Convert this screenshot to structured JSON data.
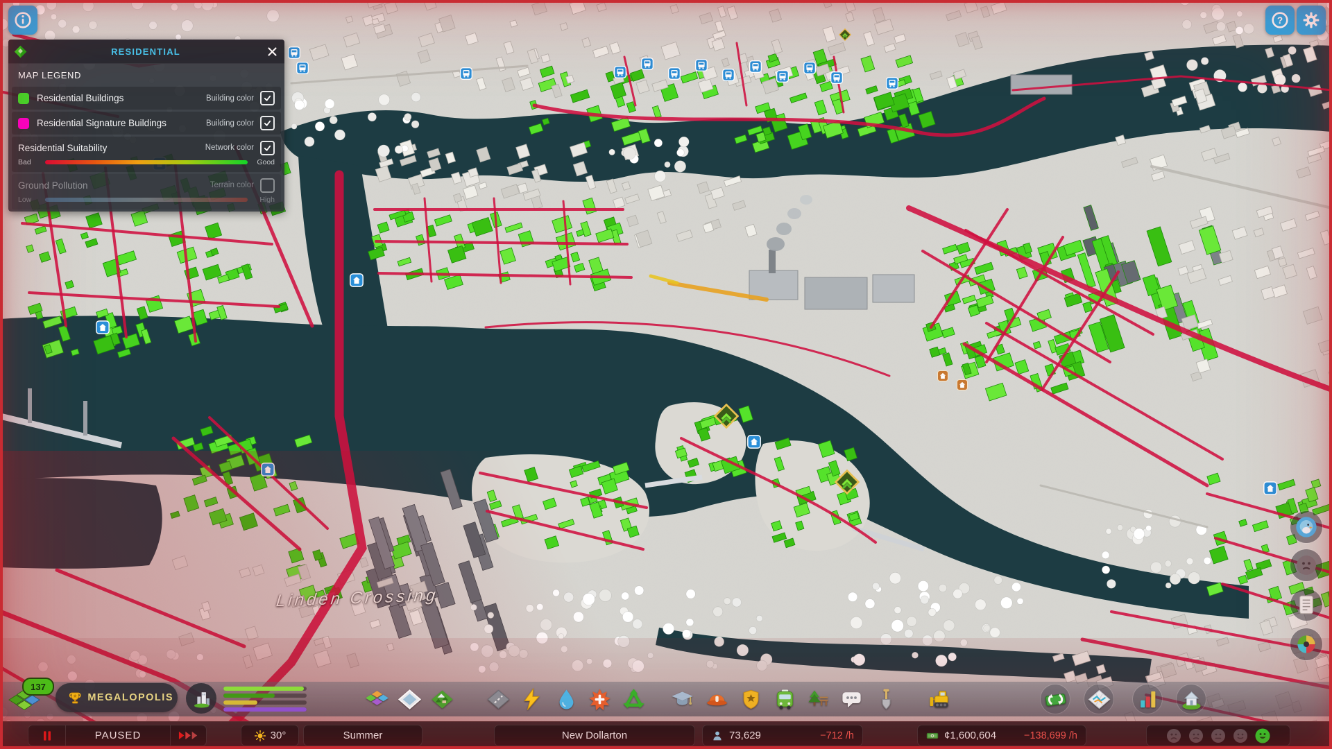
{
  "topbar": {
    "info_icon": "info-views-toggle",
    "help_icon": "help",
    "settings_icon": "gear"
  },
  "legend_panel": {
    "title": "RESIDENTIAL",
    "zone_icon": "residential-zone",
    "close_icon": "close",
    "section_title": "MAP LEGEND",
    "rows": [
      {
        "label": "Residential Buildings",
        "type_label": "Building color",
        "swatch_color": "#3ee02a",
        "checked": true
      },
      {
        "label": "Residential Signature Buildings",
        "type_label": "Building color",
        "swatch_color": "#ff00cc",
        "checked": true
      }
    ],
    "gradient_rows": [
      {
        "label": "Residential Suitability",
        "type_label": "Network color",
        "checked": true,
        "min_label": "Bad",
        "max_label": "Good",
        "enabled": true
      },
      {
        "label": "Ground Pollution",
        "type_label": "Terrain color",
        "checked": false,
        "min_label": "Low",
        "max_label": "High",
        "enabled": false
      }
    ]
  },
  "map": {
    "district_label": "Linden Crossing",
    "marker_types": [
      "transit-stop",
      "residential-service",
      "signature-unlock",
      "housing-demand"
    ]
  },
  "milestone": {
    "level": "137",
    "name": "MEGALOPOLIS"
  },
  "progress": {
    "icon": "city-development",
    "bars": [
      {
        "color": "#8ce23c",
        "value": 97
      },
      {
        "color": "#3f9e16",
        "value": 62
      },
      {
        "color": "#d8c238",
        "value": 41
      },
      {
        "color": "#8e54d8",
        "value": 100
      }
    ]
  },
  "toolbar": {
    "icons": [
      "zoning",
      "areas",
      "terraforming",
      "roads",
      "electricity",
      "water",
      "health-deathcare",
      "garbage",
      "education",
      "fire-rescue",
      "police",
      "transportation",
      "parks-recreation",
      "communications",
      "landscaping",
      "bulldozer"
    ],
    "right_icons": [
      "economy",
      "info-views",
      "statistics",
      "progression"
    ]
  },
  "side_buttons": [
    "chirper",
    "citizen-moods",
    "journal",
    "city-statistics"
  ],
  "statusbar": {
    "sim_state": "PAUSED",
    "pause_icon": "pause",
    "speed_icon": "fast-forward",
    "temperature": "30°",
    "season": "Summer",
    "city_name": "New Dollarton",
    "population": "73,629",
    "population_rate": "−712 /h",
    "money": "¢1,600,604",
    "money_rate": "−138,699 /h",
    "happiness_icons": [
      "sad",
      "displeased",
      "neutral",
      "content",
      "happy"
    ]
  },
  "colors": {
    "accent": "#45c8f1",
    "residential_green": "#3ee02a",
    "signature_magenta": "#ff00cc",
    "negative": "#ef5a52",
    "suitability_gradient": [
      "#dd0c34",
      "#f0a012",
      "#14d428"
    ],
    "pollution_gradient": [
      "#5590c0",
      "#c23a28"
    ]
  }
}
